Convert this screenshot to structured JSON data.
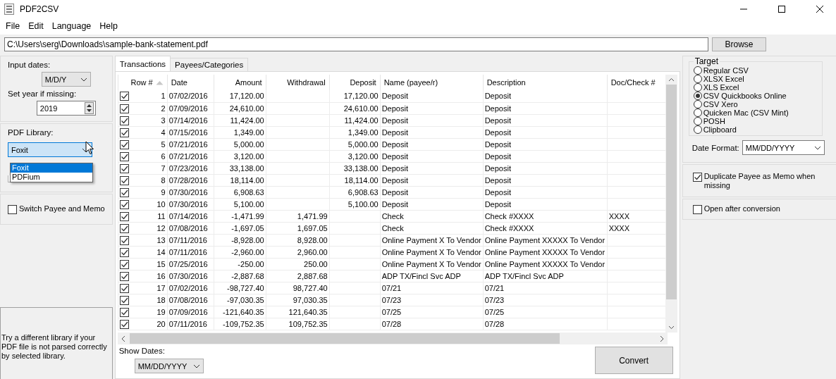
{
  "window": {
    "title": "PDF2CSV"
  },
  "menu": [
    "File",
    "Edit",
    "Language",
    "Help"
  ],
  "file_path": {
    "value": "C:\\Users\\serg\\Downloads\\sample-bank-statement.pdf"
  },
  "browse_button": "Browse",
  "input_dates": {
    "label": "Input dates:",
    "value": "M/D/Y"
  },
  "year": {
    "label": "Set year if missing:",
    "value": "2019"
  },
  "pdf_library": {
    "label": "PDF Library:",
    "value": "Foxit",
    "expanded": true,
    "options": [
      {
        "label": "Foxit",
        "selected": true
      },
      {
        "label": "PDFium",
        "selected": false
      }
    ]
  },
  "switch_payee": {
    "label": "Switch Payee and Memo",
    "checked": false
  },
  "hint": "Try a different library if your PDF file is not parsed correctly by selected library.",
  "tabs": [
    {
      "label": "Transactions",
      "selected": true
    },
    {
      "label": "Payees/Categories",
      "selected": false
    }
  ],
  "table": {
    "columns": [
      {
        "label": "Row #",
        "sorted": true
      },
      {
        "label": "Date",
        "sorted": false
      },
      {
        "label": "Amount",
        "sorted": false
      },
      {
        "label": "Withdrawal",
        "sorted": false
      },
      {
        "label": "Deposit",
        "sorted": false
      },
      {
        "label": "Name (payee/r)",
        "sorted": false
      },
      {
        "label": "Description",
        "sorted": false
      },
      {
        "label": "Doc/Check #",
        "sorted": false
      }
    ],
    "rows": [
      {
        "checked": true,
        "cells": [
          "1",
          "07/02/2016",
          "17,120.00",
          "",
          "17,120.00",
          "Deposit",
          "Deposit",
          ""
        ]
      },
      {
        "checked": true,
        "cells": [
          "2",
          "07/09/2016",
          "24,610.00",
          "",
          "24,610.00",
          "Deposit",
          "Deposit",
          ""
        ]
      },
      {
        "checked": true,
        "cells": [
          "3",
          "07/14/2016",
          "11,424.00",
          "",
          "11,424.00",
          "Deposit",
          "Deposit",
          ""
        ]
      },
      {
        "checked": true,
        "cells": [
          "4",
          "07/15/2016",
          "1,349.00",
          "",
          "1,349.00",
          "Deposit",
          "Deposit",
          ""
        ]
      },
      {
        "checked": true,
        "cells": [
          "5",
          "07/21/2016",
          "5,000.00",
          "",
          "5,000.00",
          "Deposit",
          "Deposit",
          ""
        ]
      },
      {
        "checked": true,
        "cells": [
          "6",
          "07/21/2016",
          "3,120.00",
          "",
          "3,120.00",
          "Deposit",
          "Deposit",
          ""
        ]
      },
      {
        "checked": true,
        "cells": [
          "7",
          "07/23/2016",
          "33,138.00",
          "",
          "33,138.00",
          "Deposit",
          "Deposit",
          ""
        ]
      },
      {
        "checked": true,
        "cells": [
          "8",
          "07/28/2016",
          "18,114.00",
          "",
          "18,114.00",
          "Deposit",
          "Deposit",
          ""
        ]
      },
      {
        "checked": true,
        "cells": [
          "9",
          "07/30/2016",
          "6,908.63",
          "",
          "6,908.63",
          "Deposit",
          "Deposit",
          ""
        ]
      },
      {
        "checked": true,
        "cells": [
          "10",
          "07/30/2016",
          "5,100.00",
          "",
          "5,100.00",
          "Deposit",
          "Deposit",
          ""
        ]
      },
      {
        "checked": true,
        "cells": [
          "11",
          "07/14/2016",
          "-1,471.99",
          "1,471.99",
          "",
          "Check",
          "Check #XXXX",
          "XXXX"
        ]
      },
      {
        "checked": true,
        "cells": [
          "12",
          "07/08/2016",
          "-1,697.05",
          "1,697.05",
          "",
          "Check",
          "Check #XXXX",
          "XXXX"
        ]
      },
      {
        "checked": true,
        "cells": [
          "13",
          "07/11/2016",
          "-8,928.00",
          "8,928.00",
          "",
          "Online Payment X To Vendor",
          "Online Payment XXXXX To Vendor",
          ""
        ]
      },
      {
        "checked": true,
        "cells": [
          "14",
          "07/11/2016",
          "-2,960.00",
          "2,960.00",
          "",
          "Online Payment X To Vendor",
          "Online Payment XXXXX To Vendor",
          ""
        ]
      },
      {
        "checked": true,
        "cells": [
          "15",
          "07/25/2016",
          "-250.00",
          "250.00",
          "",
          "Online Payment X To Vendor",
          "Online Payment XXXXX To Vendor",
          ""
        ]
      },
      {
        "checked": true,
        "cells": [
          "16",
          "07/30/2016",
          "-2,887.68",
          "2,887.68",
          "",
          "ADP TX/Fincl Svc ADP",
          "ADP TX/Fincl Svc ADP",
          ""
        ]
      },
      {
        "checked": true,
        "cells": [
          "17",
          "07/02/2016",
          "-98,727.40",
          "98,727.40",
          "",
          "07/21",
          "07/21",
          ""
        ]
      },
      {
        "checked": true,
        "cells": [
          "18",
          "07/08/2016",
          "-97,030.35",
          "97,030.35",
          "",
          "07/23",
          "07/23",
          ""
        ]
      },
      {
        "checked": true,
        "cells": [
          "19",
          "07/09/2016",
          "-121,640.35",
          "121,640.35",
          "",
          "07/25",
          "07/25",
          ""
        ]
      },
      {
        "checked": true,
        "cells": [
          "20",
          "07/11/2016",
          "-109,752.35",
          "109,752.35",
          "",
          "07/28",
          "07/28",
          ""
        ]
      }
    ]
  },
  "show_dates": {
    "label": "Show Dates:",
    "value": "MM/DD/YYYY"
  },
  "convert_button": "Convert",
  "target": {
    "title": "Target",
    "options": [
      {
        "label": "Regular CSV",
        "selected": false
      },
      {
        "label": "XLSX Excel",
        "selected": false
      },
      {
        "label": "XLS Excel",
        "selected": false
      },
      {
        "label": "CSV Quickbooks Online",
        "selected": true
      },
      {
        "label": "CSV Xero",
        "selected": false
      },
      {
        "label": "Quicken Mac (CSV Mint)",
        "selected": false
      },
      {
        "label": "POSH",
        "selected": false
      },
      {
        "label": "Clipboard",
        "selected": false
      }
    ]
  },
  "date_format": {
    "label": "Date Format:",
    "value": "MM/DD/YYYY"
  },
  "duplicate_payee": {
    "label": "Duplicate Payee as Memo when missing",
    "checked": true
  },
  "open_after": {
    "label": "Open after conversion",
    "checked": false
  }
}
